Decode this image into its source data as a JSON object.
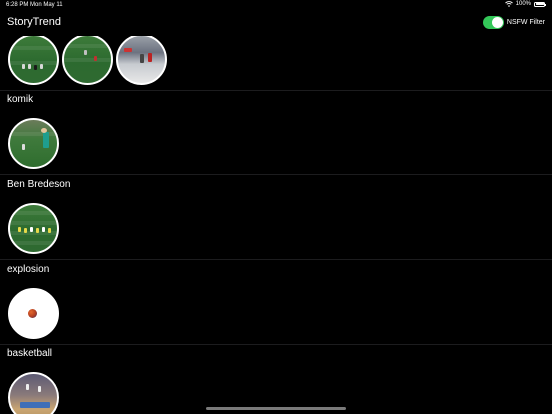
{
  "status_bar": {
    "time": "6:28 PM",
    "date": "Mon May 11",
    "battery": "100%"
  },
  "app": {
    "title": "StoryTrend",
    "nsfw_filter_label": "NSFW Filter",
    "nsfw_filter_on": true,
    "toggle_color": "#34c759"
  },
  "sections": [
    {
      "label": "",
      "thumbnails": [
        "soccer-field-thumbnail",
        "soccer-field-thumbnail",
        "hockey-rink-thumbnail"
      ]
    },
    {
      "label": "komik",
      "thumbnails": [
        "soccer-goalkeeper-thumbnail"
      ]
    },
    {
      "label": "Ben Bredeson",
      "thumbnails": [
        "football-field-thumbnail"
      ]
    },
    {
      "label": "explosion",
      "thumbnails": [
        "explosion-thumbnail"
      ]
    },
    {
      "label": "basketball",
      "thumbnails": [
        "basketball-court-thumbnail"
      ]
    }
  ]
}
